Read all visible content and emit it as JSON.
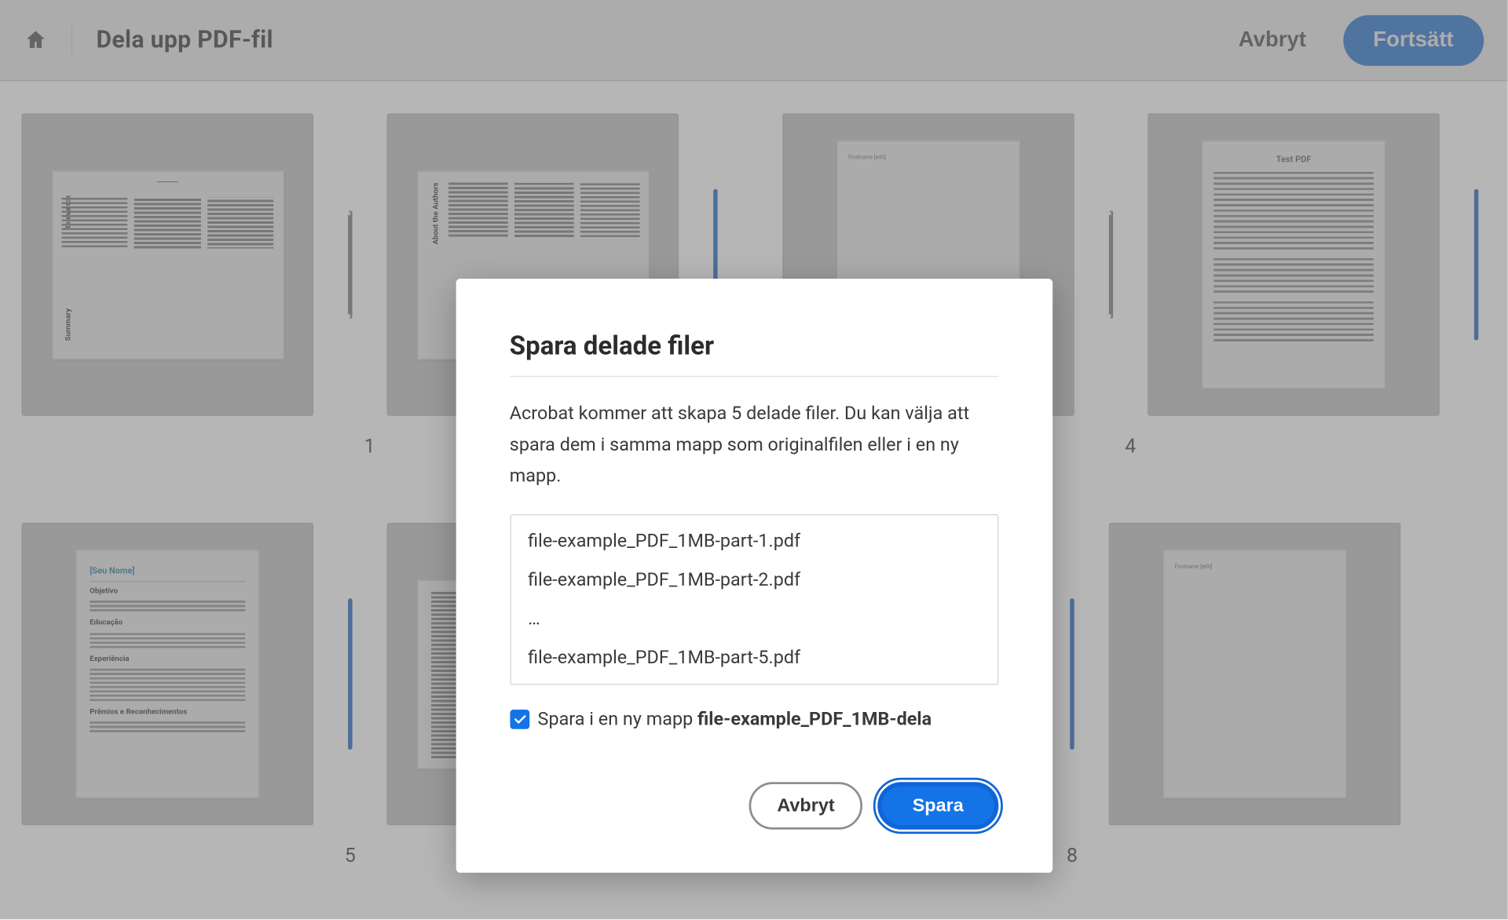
{
  "header": {
    "title": "Dela upp PDF-fil",
    "cancel": "Avbryt",
    "continue": "Fortsätt"
  },
  "pages": {
    "p1": "1",
    "p4": "4",
    "p5": "5",
    "p8": "8"
  },
  "thumbs": {
    "p1_summary": "Summary",
    "p1_relevance": "Relevance",
    "p2_about": "About the Authors",
    "p4_title": "Test PDF",
    "p3_firstname": "Firstname   [edit]",
    "p5_name": "[Seu Nome]",
    "p5_objective": "Objetivo",
    "p5_educacao": "Educação",
    "p5_experiencia": "Experiência",
    "p5_premios": "Prêmios e Reconhecimentos",
    "p8_firstname": "Firstname   [edit]"
  },
  "modal": {
    "title": "Spara delade filer",
    "description": "Acrobat kommer att skapa 5 delade filer. Du kan välja att spara dem i samma mapp som originalfilen eller i en ny mapp.",
    "files": {
      "f1": "file-example_PDF_1MB-part-1.pdf",
      "f2": "file-example_PDF_1MB-part-2.pdf",
      "ellipsis": "…",
      "f5": "file-example_PDF_1MB-part-5.pdf"
    },
    "checkbox_label": "Spara i en ny mapp ",
    "folder_name": "file-example_PDF_1MB-dela",
    "btn_cancel": "Avbryt",
    "btn_save": "Spara"
  }
}
